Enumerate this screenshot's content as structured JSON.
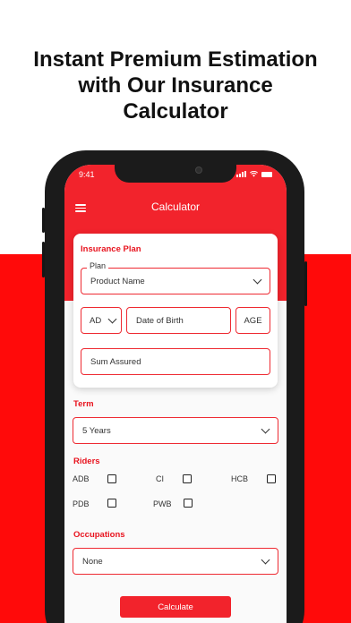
{
  "headline": {
    "line1": "Instant Premium Estimation",
    "line2": "with Our Insurance",
    "line3": "Calculator"
  },
  "status_bar": {
    "time": "9:41"
  },
  "app": {
    "title": "Calculator"
  },
  "insurance_plan": {
    "section_label": "Insurance Plan",
    "plan_label": "Plan",
    "plan_value": "Product Name",
    "calendar_type": "AD",
    "date_of_birth_placeholder": "Date of Birth",
    "age_placeholder": "AGE",
    "sum_assured_placeholder": "Sum Assured"
  },
  "term": {
    "label": "Term",
    "value": "5 Years"
  },
  "riders": {
    "label": "Riders",
    "items": [
      {
        "label": "ADB",
        "checked": false
      },
      {
        "label": "CI",
        "checked": false
      },
      {
        "label": "HCB",
        "checked": false
      },
      {
        "label": "PDB",
        "checked": false
      },
      {
        "label": "PWB",
        "checked": false
      }
    ]
  },
  "occupations": {
    "label": "Occupations",
    "value": "None"
  },
  "actions": {
    "calculate_label": "Calculate"
  },
  "colors": {
    "brand_red": "#f2232c",
    "band_red": "#ff0a0a",
    "frame": "#1b1b1b"
  }
}
